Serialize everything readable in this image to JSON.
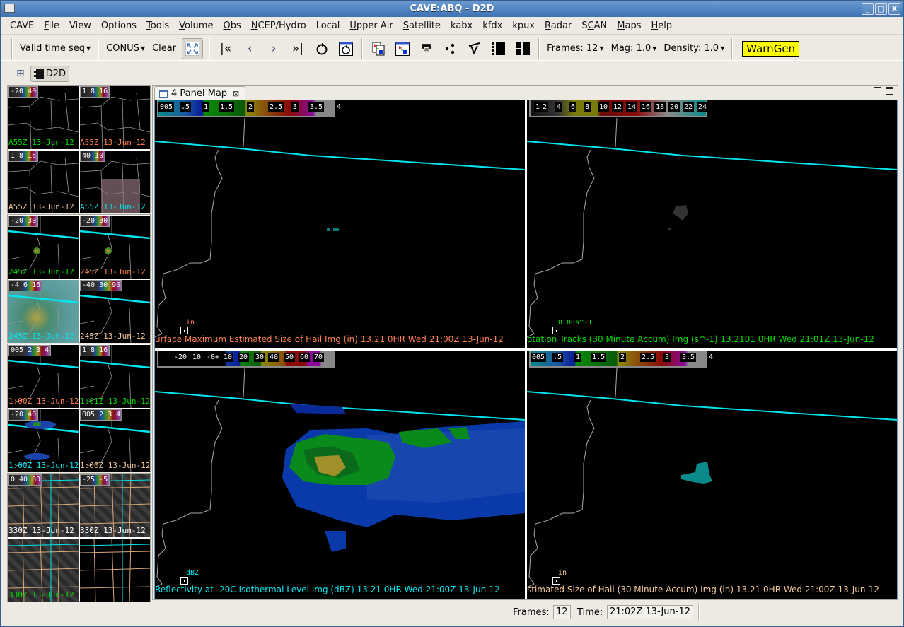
{
  "window": {
    "title": "CAVE:ABQ - D2D",
    "controls": [
      "minimize",
      "maximize",
      "close"
    ]
  },
  "menubar": {
    "items": [
      {
        "label": "CAVE",
        "mnemonic": ""
      },
      {
        "label": "File",
        "mnemonic": "F"
      },
      {
        "label": "View",
        "mnemonic": ""
      },
      {
        "label": "Options",
        "mnemonic": ""
      },
      {
        "label": "Tools",
        "mnemonic": "T"
      },
      {
        "label": "Volume",
        "mnemonic": "V"
      },
      {
        "label": "Obs",
        "mnemonic": "O"
      },
      {
        "label": "NCEP/Hydro",
        "mnemonic": "N"
      },
      {
        "label": "Local",
        "mnemonic": ""
      },
      {
        "label": "Upper Air",
        "mnemonic": "U"
      },
      {
        "label": "Satellite",
        "mnemonic": "S"
      },
      {
        "label": "kabx",
        "mnemonic": ""
      },
      {
        "label": "kfdx",
        "mnemonic": ""
      },
      {
        "label": "kpux",
        "mnemonic": ""
      },
      {
        "label": "Radar",
        "mnemonic": "R"
      },
      {
        "label": "SCAN",
        "mnemonic": "C"
      },
      {
        "label": "Maps",
        "mnemonic": "M"
      },
      {
        "label": "Help",
        "mnemonic": "H"
      }
    ]
  },
  "toolbar": {
    "time_mode": "Valid time seq",
    "scale": "CONUS",
    "clear": "Clear",
    "frames": "Frames: 12",
    "mag": "Mag: 1.0",
    "density": "Density: 1.0",
    "warngen": "WarnGen",
    "icons": {
      "zoom_full": "fit-to-screen-icon",
      "first": "first-frame-icon",
      "prev": "previous-frame-icon",
      "next": "next-frame-icon",
      "last": "last-frame-icon",
      "loop": "loop-icon",
      "loop_props": "loop-properties-icon",
      "copy": "copy-image-icon",
      "new_window": "new-window-icon",
      "print": "print-icon",
      "points": "points-icon",
      "baselines": "baselines-icon",
      "panel_single": "single-panel-icon",
      "panel_four": "four-panel-icon"
    }
  },
  "perspective": {
    "open_label": "open-perspective",
    "d2d_label": "D2D"
  },
  "editor": {
    "tab_label": "4 Panel Map"
  },
  "panels": [
    {
      "colorbar_labels": [
        "005",
        ".5",
        "1",
        "1.5",
        "2",
        "2.5",
        "3",
        "3.5",
        "4"
      ],
      "title": "urface Maximum Estimated Size of Hail Img (in)    13.21    0HR Wed 21:00Z 13-Jun-12",
      "unit": "in",
      "title_color": "#ff7f50"
    },
    {
      "colorbar_labels": [
        "1",
        "2",
        "4",
        "6",
        "8",
        "10",
        "12",
        "14",
        "16",
        "18",
        "20",
        "22",
        "24"
      ],
      "title": "otation Tracks (30 Minute Accum) Img (s^-1)    13.2101    0HR Wed 21:01Z 13-Jun-12",
      "unit": "0.00s^-1",
      "title_color": "#00dd00"
    },
    {
      "colorbar_labels": [
        "-20",
        "10",
        "-0+",
        "10",
        "20",
        "30",
        "40",
        "50",
        "60",
        "70"
      ],
      "title": "Reflectivity at -20C Isothermal Level Img (dBZ)    13.21    0HR Wed 21:00Z 13-Jun-12",
      "unit": "dBZ",
      "title_color": "#00e5ee"
    },
    {
      "colorbar_labels": [
        "005",
        ".5",
        "1",
        "1.5",
        "2",
        "2.5",
        "3",
        "3.5",
        "4"
      ],
      "title": "stimated Size of Hail (30 Minute Accum) Img (in)    13.21    0HR Wed 21:00Z 13-Jun-12",
      "unit": "in",
      "title_color": "#f5c89a"
    }
  ],
  "thumbnails": [
    {
      "cells": [
        {
          "legend": "-20 40",
          "time": "A55Z 13-Jun-12",
          "color": "#00dd00"
        },
        {
          "legend": "1 8 16",
          "time": "A55Z 13-Jun-12",
          "color": "#ff7f50"
        },
        {
          "legend": "1 8 16",
          "time": "A55Z 13-Jun-12",
          "color": "#f5c89a"
        },
        {
          "legend": "40 10",
          "time": "A55Z 13-Jun-12",
          "color": "#00e5ee"
        }
      ]
    },
    {
      "cells": [
        {
          "legend": "-20 30",
          "time": "245Z 13-Jun-12",
          "color": "#00dd00"
        },
        {
          "legend": "-20 30",
          "time": "245Z 13-Jun-12",
          "color": "#ff7f50"
        },
        {
          "legend": "-4 6 16",
          "time": "245Z 13-Jun-12",
          "color": "#00e5ee"
        },
        {
          "legend": "-40 30 90",
          "time": "245Z 13-Jun-12",
          "color": "#f5c89a"
        }
      ]
    },
    {
      "cells": [
        {
          "legend": "005 2 3 4",
          "time": "1:00Z 13-Jun-12",
          "color": "#ff7f50"
        },
        {
          "legend": "1 8 16",
          "time": "1:01Z 13-Jun-12",
          "color": "#00dd00"
        },
        {
          "legend": "-20 40",
          "time": "1:00Z 13-Jun-12",
          "color": "#00e5ee"
        },
        {
          "legend": "005 2 3 4",
          "time": "1:00Z 13-Jun-12",
          "color": "#f5c89a"
        }
      ]
    },
    {
      "cells": [
        {
          "legend": "0 40 80",
          "time": "330Z 13-Jun-12",
          "color": "#ffffff"
        },
        {
          "legend": "-25 -5",
          "time": "330Z 13-Jun-12",
          "color": "#ffffff"
        },
        {
          "legend": "",
          "time": "330Z 13-Jun-12",
          "color": "#00dd00"
        },
        {
          "legend": "",
          "time": "",
          "color": "#ffffff"
        }
      ]
    }
  ],
  "statusbar": {
    "frames_label": "Frames:",
    "frames_value": "12",
    "time_label": "Time:",
    "time_value": "21:02Z 13-Jun-12"
  }
}
